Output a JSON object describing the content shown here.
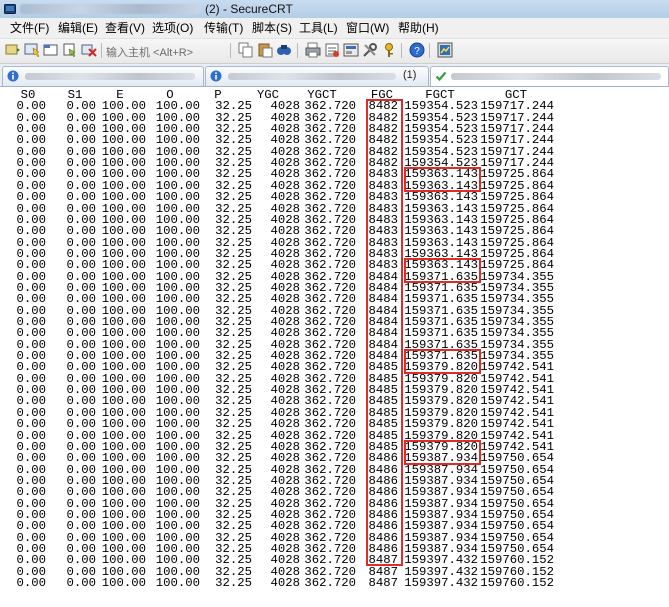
{
  "window": {
    "title_suffix": "(2) - SecureCRT"
  },
  "menu": [
    "文件(F)",
    "编辑(E)",
    "查看(V)",
    "选项(O)",
    "传输(T)",
    "脚本(S)",
    "工具(L)",
    "窗口(W)",
    "帮助(H)"
  ],
  "toolbar": {
    "quick_connect_placeholder": "输入主机 <Alt+R>",
    "icons": [
      "connect-icon",
      "quick-connect-icon",
      "connect-in-tab-icon",
      "reconnect-icon",
      "disconnect-icon",
      "copy-icon",
      "paste-icon",
      "find-icon",
      "print-icon",
      "print-setup-icon",
      "session-options-icon",
      "global-options-icon",
      "keymap-icon",
      "help-icon",
      "sftp-icon"
    ]
  },
  "tabs": [
    {
      "status_icon": "info-icon",
      "number": ""
    },
    {
      "status_icon": "info-icon",
      "number": "(1)"
    },
    {
      "status_icon": "check-icon",
      "number": ""
    }
  ],
  "terminal": {
    "headers": [
      "S0",
      "S1",
      "E",
      "O",
      "P",
      "YGC",
      "YGCT",
      "FGC",
      "FGCT",
      "GCT"
    ],
    "rows": [
      [
        "0.00",
        "0.00",
        "100.00",
        "100.00",
        "32.25",
        "4028",
        "362.720",
        "8482",
        "159354.523",
        "159717.244"
      ],
      [
        "0.00",
        "0.00",
        "100.00",
        "100.00",
        "32.25",
        "4028",
        "362.720",
        "8482",
        "159354.523",
        "159717.244"
      ],
      [
        "0.00",
        "0.00",
        "100.00",
        "100.00",
        "32.25",
        "4028",
        "362.720",
        "8482",
        "159354.523",
        "159717.244"
      ],
      [
        "0.00",
        "0.00",
        "100.00",
        "100.00",
        "32.25",
        "4028",
        "362.720",
        "8482",
        "159354.523",
        "159717.244"
      ],
      [
        "0.00",
        "0.00",
        "100.00",
        "100.00",
        "32.25",
        "4028",
        "362.720",
        "8482",
        "159354.523",
        "159717.244"
      ],
      [
        "0.00",
        "0.00",
        "100.00",
        "100.00",
        "32.25",
        "4028",
        "362.720",
        "8482",
        "159354.523",
        "159717.244"
      ],
      [
        "0.00",
        "0.00",
        "100.00",
        "100.00",
        "32.25",
        "4028",
        "362.720",
        "8483",
        "159363.143",
        "159725.864"
      ],
      [
        "0.00",
        "0.00",
        "100.00",
        "100.00",
        "32.25",
        "4028",
        "362.720",
        "8483",
        "159363.143",
        "159725.864"
      ],
      [
        "0.00",
        "0.00",
        "100.00",
        "100.00",
        "32.25",
        "4028",
        "362.720",
        "8483",
        "159363.143",
        "159725.864"
      ],
      [
        "0.00",
        "0.00",
        "100.00",
        "100.00",
        "32.25",
        "4028",
        "362.720",
        "8483",
        "159363.143",
        "159725.864"
      ],
      [
        "0.00",
        "0.00",
        "100.00",
        "100.00",
        "32.25",
        "4028",
        "362.720",
        "8483",
        "159363.143",
        "159725.864"
      ],
      [
        "0.00",
        "0.00",
        "100.00",
        "100.00",
        "32.25",
        "4028",
        "362.720",
        "8483",
        "159363.143",
        "159725.864"
      ],
      [
        "0.00",
        "0.00",
        "100.00",
        "100.00",
        "32.25",
        "4028",
        "362.720",
        "8483",
        "159363.143",
        "159725.864"
      ],
      [
        "0.00",
        "0.00",
        "100.00",
        "100.00",
        "32.25",
        "4028",
        "362.720",
        "8483",
        "159363.143",
        "159725.864"
      ],
      [
        "0.00",
        "0.00",
        "100.00",
        "100.00",
        "32.25",
        "4028",
        "362.720",
        "8483",
        "159363.143",
        "159725.864"
      ],
      [
        "0.00",
        "0.00",
        "100.00",
        "100.00",
        "32.25",
        "4028",
        "362.720",
        "8484",
        "159371.635",
        "159734.355"
      ],
      [
        "0.00",
        "0.00",
        "100.00",
        "100.00",
        "32.25",
        "4028",
        "362.720",
        "8484",
        "159371.635",
        "159734.355"
      ],
      [
        "0.00",
        "0.00",
        "100.00",
        "100.00",
        "32.25",
        "4028",
        "362.720",
        "8484",
        "159371.635",
        "159734.355"
      ],
      [
        "0.00",
        "0.00",
        "100.00",
        "100.00",
        "32.25",
        "4028",
        "362.720",
        "8484",
        "159371.635",
        "159734.355"
      ],
      [
        "0.00",
        "0.00",
        "100.00",
        "100.00",
        "32.25",
        "4028",
        "362.720",
        "8484",
        "159371.635",
        "159734.355"
      ],
      [
        "0.00",
        "0.00",
        "100.00",
        "100.00",
        "32.25",
        "4028",
        "362.720",
        "8484",
        "159371.635",
        "159734.355"
      ],
      [
        "0.00",
        "0.00",
        "100.00",
        "100.00",
        "32.25",
        "4028",
        "362.720",
        "8484",
        "159371.635",
        "159734.355"
      ],
      [
        "0.00",
        "0.00",
        "100.00",
        "100.00",
        "32.25",
        "4028",
        "362.720",
        "8484",
        "159371.635",
        "159734.355"
      ],
      [
        "0.00",
        "0.00",
        "100.00",
        "100.00",
        "32.25",
        "4028",
        "362.720",
        "8485",
        "159379.820",
        "159742.541"
      ],
      [
        "0.00",
        "0.00",
        "100.00",
        "100.00",
        "32.25",
        "4028",
        "362.720",
        "8485",
        "159379.820",
        "159742.541"
      ],
      [
        "0.00",
        "0.00",
        "100.00",
        "100.00",
        "32.25",
        "4028",
        "362.720",
        "8485",
        "159379.820",
        "159742.541"
      ],
      [
        "0.00",
        "0.00",
        "100.00",
        "100.00",
        "32.25",
        "4028",
        "362.720",
        "8485",
        "159379.820",
        "159742.541"
      ],
      [
        "0.00",
        "0.00",
        "100.00",
        "100.00",
        "32.25",
        "4028",
        "362.720",
        "8485",
        "159379.820",
        "159742.541"
      ],
      [
        "0.00",
        "0.00",
        "100.00",
        "100.00",
        "32.25",
        "4028",
        "362.720",
        "8485",
        "159379.820",
        "159742.541"
      ],
      [
        "0.00",
        "0.00",
        "100.00",
        "100.00",
        "32.25",
        "4028",
        "362.720",
        "8485",
        "159379.820",
        "159742.541"
      ],
      [
        "0.00",
        "0.00",
        "100.00",
        "100.00",
        "32.25",
        "4028",
        "362.720",
        "8485",
        "159379.820",
        "159742.541"
      ],
      [
        "0.00",
        "0.00",
        "100.00",
        "100.00",
        "32.25",
        "4028",
        "362.720",
        "8486",
        "159387.934",
        "159750.654"
      ],
      [
        "0.00",
        "0.00",
        "100.00",
        "100.00",
        "32.25",
        "4028",
        "362.720",
        "8486",
        "159387.934",
        "159750.654"
      ],
      [
        "0.00",
        "0.00",
        "100.00",
        "100.00",
        "32.25",
        "4028",
        "362.720",
        "8486",
        "159387.934",
        "159750.654"
      ],
      [
        "0.00",
        "0.00",
        "100.00",
        "100.00",
        "32.25",
        "4028",
        "362.720",
        "8486",
        "159387.934",
        "159750.654"
      ],
      [
        "0.00",
        "0.00",
        "100.00",
        "100.00",
        "32.25",
        "4028",
        "362.720",
        "8486",
        "159387.934",
        "159750.654"
      ],
      [
        "0.00",
        "0.00",
        "100.00",
        "100.00",
        "32.25",
        "4028",
        "362.720",
        "8486",
        "159387.934",
        "159750.654"
      ],
      [
        "0.00",
        "0.00",
        "100.00",
        "100.00",
        "32.25",
        "4028",
        "362.720",
        "8486",
        "159387.934",
        "159750.654"
      ],
      [
        "0.00",
        "0.00",
        "100.00",
        "100.00",
        "32.25",
        "4028",
        "362.720",
        "8486",
        "159387.934",
        "159750.654"
      ],
      [
        "0.00",
        "0.00",
        "100.00",
        "100.00",
        "32.25",
        "4028",
        "362.720",
        "8486",
        "159387.934",
        "159750.654"
      ],
      [
        "0.00",
        "0.00",
        "100.00",
        "100.00",
        "32.25",
        "4028",
        "362.720",
        "8487",
        "159397.432",
        "159760.152"
      ],
      [
        "0.00",
        "0.00",
        "100.00",
        "100.00",
        "32.25",
        "4028",
        "362.720",
        "8487",
        "159397.432",
        "159760.152"
      ],
      [
        "0.00",
        "0.00",
        "100.00",
        "100.00",
        "32.25",
        "4028",
        "362.720",
        "8487",
        "159397.432",
        "159760.152"
      ]
    ]
  },
  "colors": {
    "highlight_box": "#e02b2b",
    "tab_check": "#2e9e3e",
    "tab_info": "#2f6fcf"
  }
}
